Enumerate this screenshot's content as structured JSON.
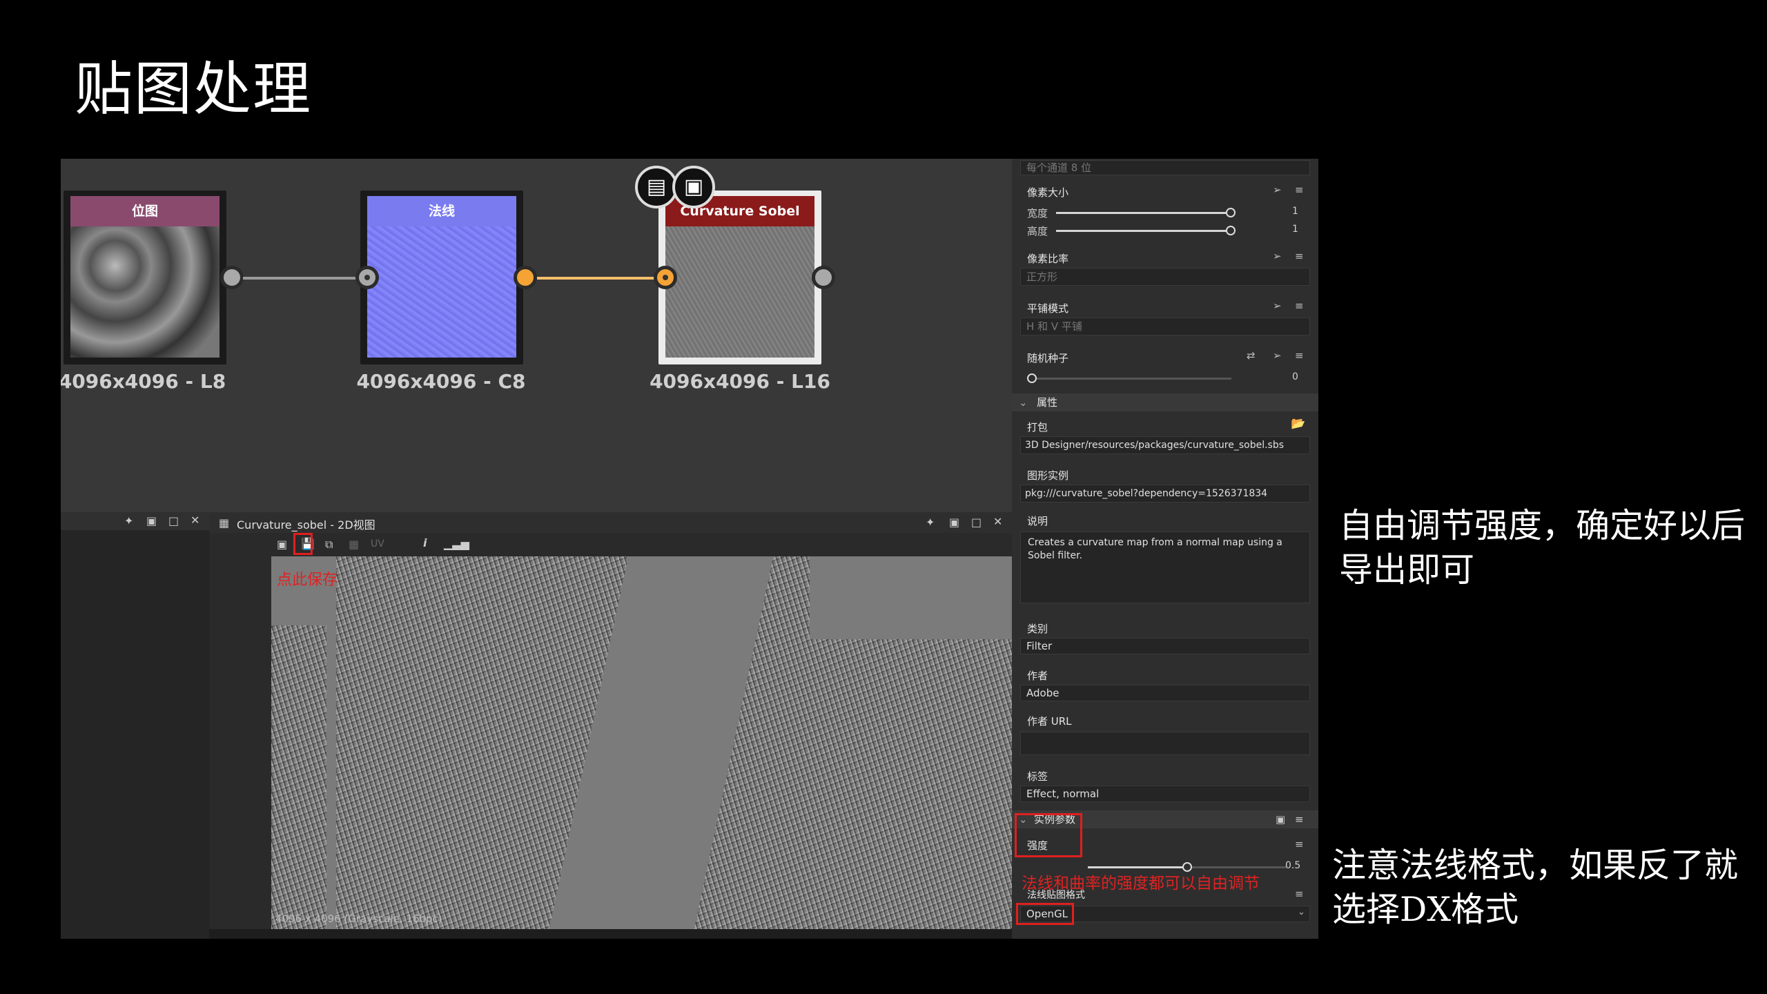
{
  "slide": {
    "title": "贴图处理",
    "note_top": "自由调节强度，确定好以后导出即可",
    "note_bottom": "注意法线格式，如果反了就选择DX格式"
  },
  "graph": {
    "nodes": [
      {
        "title": "位图",
        "resolution": "4096x4096 - L8",
        "color": "#8a4a6e"
      },
      {
        "title": "法线",
        "resolution": "4096x4096 - C8",
        "color": "#7b7bf0"
      },
      {
        "title": "Curvature Sobel",
        "resolution": "4096x4096 - L16",
        "color": "#8b1a1a"
      }
    ],
    "link_color": "#f5c06a"
  },
  "view2d": {
    "title": "Curvature_sobel - 2D视图",
    "toolbar_uv": "UV",
    "save_hint": "点此保存",
    "image_info": "4096 x 4096 (Grayscale, 16bpc)"
  },
  "props": {
    "bits_per_channel": "每个通道 8 位",
    "pixel_size_label": "像素大小",
    "width_label": "宽度",
    "width_value": "1",
    "height_label": "高度",
    "height_value": "1",
    "pixel_ratio_label": "像素比率",
    "pixel_ratio_value": "正方形",
    "tiling_label": "平铺模式",
    "tiling_value": "H 和 V 平铺",
    "seed_label": "随机种子",
    "seed_value": "0",
    "attributes_section": "属性",
    "package_label": "打包",
    "package_value": "3D Designer/resources/packages/curvature_sobel.sbs",
    "graph_instance_label": "图形实例",
    "graph_instance_value": "pkg:///curvature_sobel?dependency=1526371834",
    "description_label": "说明",
    "description_value": "Creates a curvature map from a normal map using a Sobel filter.",
    "category_label": "类别",
    "category_value": "Filter",
    "author_label": "作者",
    "author_value": "Adobe",
    "author_url_label": "作者 URL",
    "author_url_value": "",
    "tags_label": "标签",
    "tags_value": "Effect, normal",
    "instance_params_section": "实例参数",
    "intensity_label": "强度",
    "intensity_value": "0.5",
    "intensity_fraction": 0.5,
    "intensity_hint": "法线和曲率的强度都可以自由调节",
    "normal_format_label": "法线贴图格式",
    "normal_format_value": "OpenGL"
  }
}
